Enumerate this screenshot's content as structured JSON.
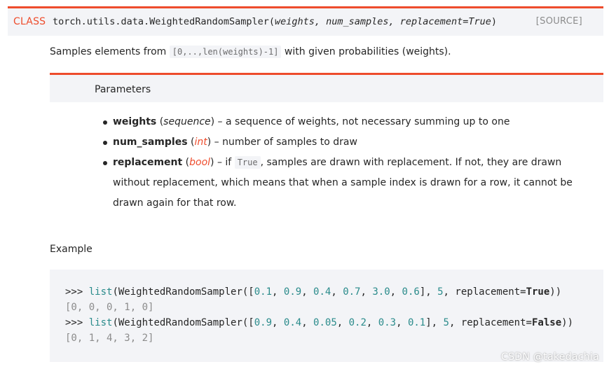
{
  "signature": {
    "keyword": "CLASS",
    "name": "torch.utils.data.WeightedRandomSampler(",
    "params": "weights, num_samples, replacement=True",
    "close": ")",
    "source_label": "[SOURCE]"
  },
  "description": {
    "before": "Samples elements from ",
    "code": "[0,..,len(weights)-1]",
    "after": " with given probabilities (weights)."
  },
  "parameters": {
    "title": "Parameters",
    "items": [
      {
        "name": "weights",
        "type_open": " (",
        "type": "sequence",
        "type_close": ")",
        "desc": " – a sequence of weights, not necessary summing up to one"
      },
      {
        "name": "num_samples",
        "type_open": " (",
        "type": "int",
        "type_close": ")",
        "desc": " – number of samples to draw"
      },
      {
        "name": "replacement",
        "type_open": " (",
        "type": "bool",
        "type_close": ")",
        "desc_before": " – if ",
        "desc_code": "True",
        "desc": ", samples are drawn with replacement. If not, they are drawn without replacement, which means that when a sample index is drawn for a row, it cannot be drawn again for that row."
      }
    ]
  },
  "example": {
    "title": "Example",
    "lines": [
      {
        "prompt": ">>> ",
        "fn": "list",
        "a": "(WeightedRandomSampler([",
        "n1": "0.1",
        "n2": "0.9",
        "n3": "0.4",
        "n4": "0.7",
        "n5": "3.0",
        "n6": "0.6",
        "count": "5",
        "kw": "replacement=",
        "bool": "True",
        "end": "))"
      },
      {
        "output": "[0, 0, 0, 1, 0]"
      },
      {
        "prompt": ">>> ",
        "fn": "list",
        "a": "(WeightedRandomSampler([",
        "n1": "0.9",
        "n2": "0.4",
        "n3": "0.05",
        "n4": "0.2",
        "n5": "0.3",
        "n6": "0.1",
        "count": "5",
        "kw": "replacement=",
        "bool": "False",
        "end": "))"
      },
      {
        "output": "[0, 1, 4, 3, 2]"
      }
    ]
  },
  "watermark": "CSDN @takedachia"
}
